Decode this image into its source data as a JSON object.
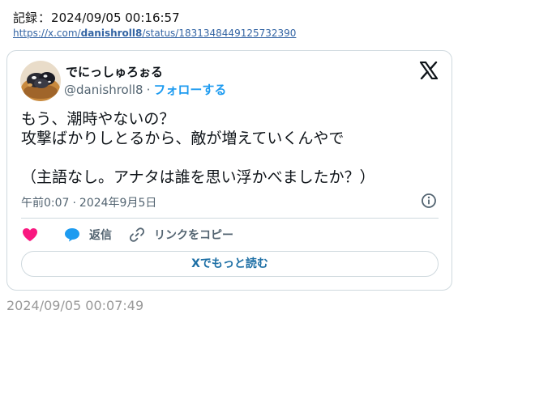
{
  "record": {
    "label": "記録",
    "separator": "：",
    "timestamp": "2024/09/05 00:16:57"
  },
  "source": {
    "prefix": "https://x.com/",
    "handle_bold": "danishroll8",
    "suffix": "/status/1831348449125732390"
  },
  "tweet": {
    "author_name": "でにっしゅろぉる",
    "author_handle": "@danishroll8",
    "meta_dot": "·",
    "follow_label": "フォローする",
    "text": "もう、潮時やないの？\n攻撃ばかりしとるから、敵が増えていくんやで\n\n（主語なし。アナタは誰を思い浮かべましたか？）",
    "time": "午前0:07",
    "date": "2024年9月5日",
    "reply_label": "返信",
    "copy_link_label": "リンクをコピー",
    "read_more_label": "Xでもっと読む"
  },
  "icons": {
    "x_logo": "x-logo-icon",
    "info": "info-icon",
    "like": "heart-icon",
    "reply": "speech-bubble-icon",
    "copy_link": "link-icon"
  },
  "colors": {
    "like": "#f91880",
    "reply": "#1d9bf0",
    "follow": "#1d9bf0",
    "link": "#3465a4",
    "read_more": "#1d6fa5"
  },
  "footer": {
    "timestamp": "2024/09/05 00:07:49"
  }
}
